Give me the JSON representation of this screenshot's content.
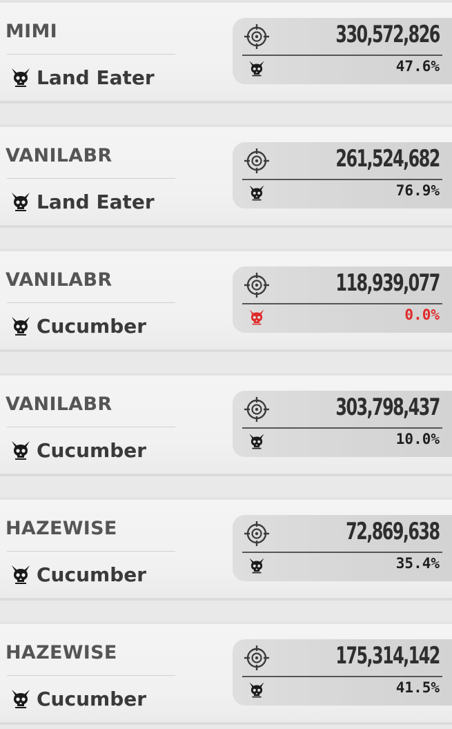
{
  "colors": {
    "normal_text": "#1f1f1f",
    "zero_highlight": "#e02a2a",
    "icon_dark": "#1a1a1a"
  },
  "icons": {
    "boss": "boss-skull-icon",
    "damage": "crosshair-target-icon"
  },
  "entries": [
    {
      "player": "MIMI",
      "boss": "Land Eater",
      "damage": "330,572,826",
      "percent": "47.6%",
      "zero": false
    },
    {
      "player": "VANILABR",
      "boss": "Land Eater",
      "damage": "261,524,682",
      "percent": "76.9%",
      "zero": false
    },
    {
      "player": "VANILABR",
      "boss": "Cucumber",
      "damage": "118,939,077",
      "percent": "0.0%",
      "zero": true
    },
    {
      "player": "VANILABR",
      "boss": "Cucumber",
      "damage": "303,798,437",
      "percent": "10.0%",
      "zero": false
    },
    {
      "player": "HAZEWISE",
      "boss": "Cucumber",
      "damage": "72,869,638",
      "percent": "35.4%",
      "zero": false
    },
    {
      "player": "HAZEWISE",
      "boss": "Cucumber",
      "damage": "175,314,142",
      "percent": "41.5%",
      "zero": false
    }
  ]
}
